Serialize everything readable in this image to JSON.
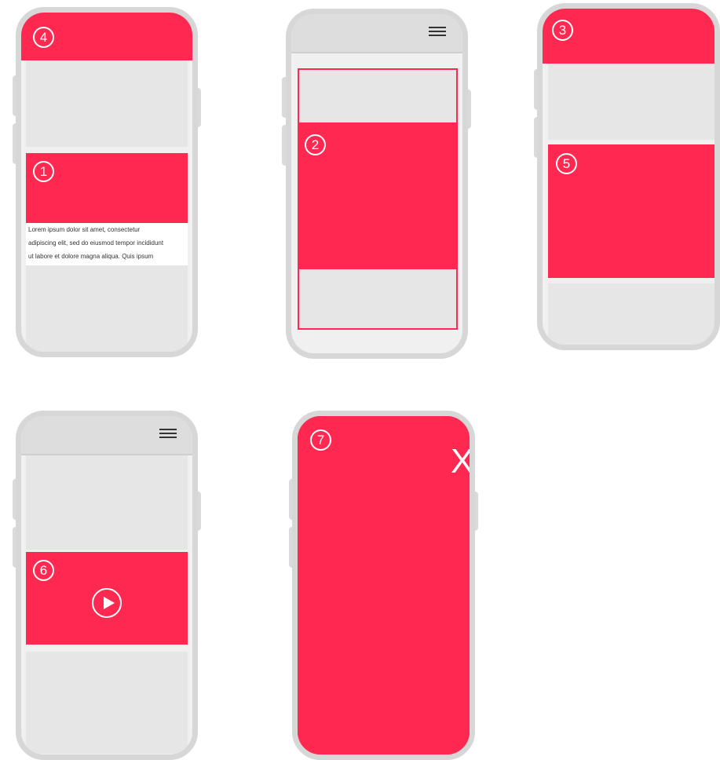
{
  "colors": {
    "accent": "#ff2851",
    "block": "#e6e6e6",
    "frame": "#d7d7d7",
    "topbar": "#dddddd"
  },
  "phones": [
    {
      "number": "4",
      "content_number": "1",
      "text": "Lorem ipsum dolor sit amet, consectetur\nadipiscing elit, sed do eiusmod tempor incididunt\nut labore et dolore magna aliqua. Quis ipsum"
    },
    {
      "number": "2",
      "has_menu": true,
      "menu_icon": "hamburger-icon"
    },
    {
      "number": "3",
      "content_number": "5"
    },
    {
      "number": "6",
      "has_menu": true,
      "menu_icon": "hamburger-icon",
      "media_icon": "play-icon"
    },
    {
      "number": "7",
      "close_label": "X"
    }
  ]
}
